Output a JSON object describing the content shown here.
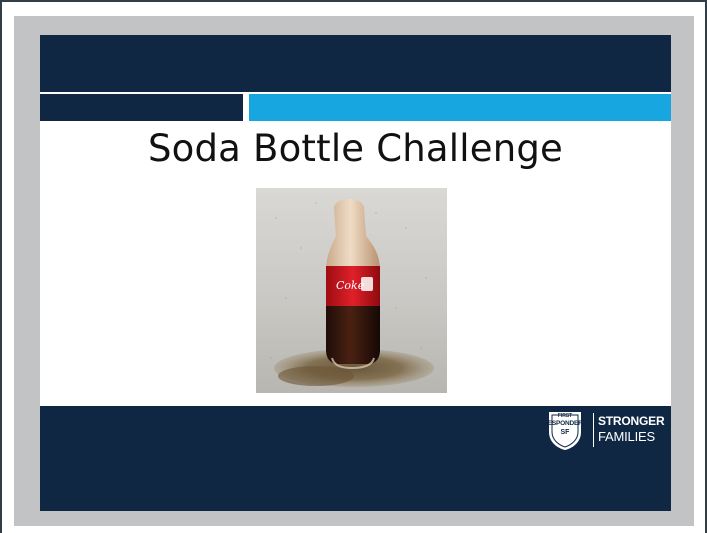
{
  "slide": {
    "title": "Soda Bottle Challenge",
    "photo_icon": "soda-bottle-photo",
    "logo": {
      "shield_line1": "FIRST",
      "shield_line2": "RESPONDERS",
      "shield_line3": "SF",
      "brand_line1": "STRONGER",
      "brand_line2": "FAMILIES"
    }
  },
  "colors": {
    "navy": "#0f2742",
    "blue_accent": "#18a6e0",
    "bezel_gray": "#c2c3c5"
  }
}
